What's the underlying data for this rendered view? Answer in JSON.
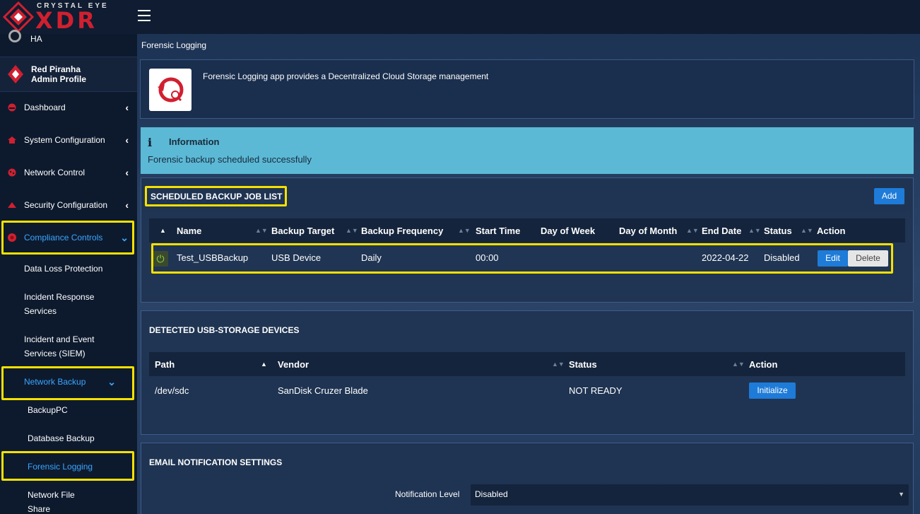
{
  "brand": {
    "top": "CRYSTAL EYE",
    "main": "XDR"
  },
  "sidebar": {
    "ha_label": "HA",
    "profile": {
      "name": "Red Piranha",
      "role": "Admin Profile"
    },
    "items": [
      {
        "label": "Dashboard",
        "icon": "dashboard-icon",
        "chevron": "‹"
      },
      {
        "label": "System Configuration",
        "icon": "house-icon",
        "chevron": "‹"
      },
      {
        "label": "Network Control",
        "icon": "network-icon",
        "chevron": "‹"
      },
      {
        "label": "Security Configuration",
        "icon": "triangle-icon",
        "chevron": "‹"
      },
      {
        "label": "Compliance Controls",
        "icon": "compliance-icon",
        "chevron": "⌄"
      }
    ],
    "compliance_sub": [
      "Data Loss Protection",
      "Incident Response Services",
      "Incident and Event Services (SIEM)"
    ],
    "network_backup": {
      "label": "Network Backup",
      "chevron": "⌄"
    },
    "backup_sub": [
      "BackupPC",
      "Database Backup",
      "Forensic Logging",
      "Network File Share"
    ]
  },
  "main": {
    "page_title": "Forensic Logging",
    "app_description": "Forensic Logging app provides a Decentralized Cloud Storage management",
    "info": {
      "icon": "i",
      "title": "Information",
      "message": "Forensic backup scheduled successfully"
    },
    "scheduled": {
      "title": "SCHEDULED BACKUP JOB LIST",
      "add_label": "Add",
      "columns": [
        "Name",
        "Backup Target",
        "Backup Frequency",
        "Start Time",
        "Day of Week",
        "Day of Month",
        "End Date",
        "Status",
        "Action"
      ],
      "rows": [
        {
          "name": "Test_USBBackup",
          "target": "USB Device",
          "frequency": "Daily",
          "start": "00:00",
          "dow": "",
          "dom": "",
          "end": "2022-04-22",
          "status": "Disabled",
          "edit": "Edit",
          "delete": "Delete"
        }
      ]
    },
    "usb": {
      "title": "DETECTED USB-STORAGE DEVICES",
      "columns": [
        "Path",
        "Vendor",
        "Status",
        "Action"
      ],
      "rows": [
        {
          "path": "/dev/sdc",
          "vendor": "SanDisk Cruzer Blade",
          "status": "NOT READY",
          "action": "Initialize"
        }
      ]
    },
    "email": {
      "title": "EMAIL NOTIFICATION SETTINGS",
      "label": "Notification Level",
      "value": "Disabled"
    }
  },
  "colors": {
    "accent": "#1e7bd8",
    "highlight": "#f5e000",
    "info_bg": "#5bb9d6",
    "brand_red": "#d02030"
  }
}
